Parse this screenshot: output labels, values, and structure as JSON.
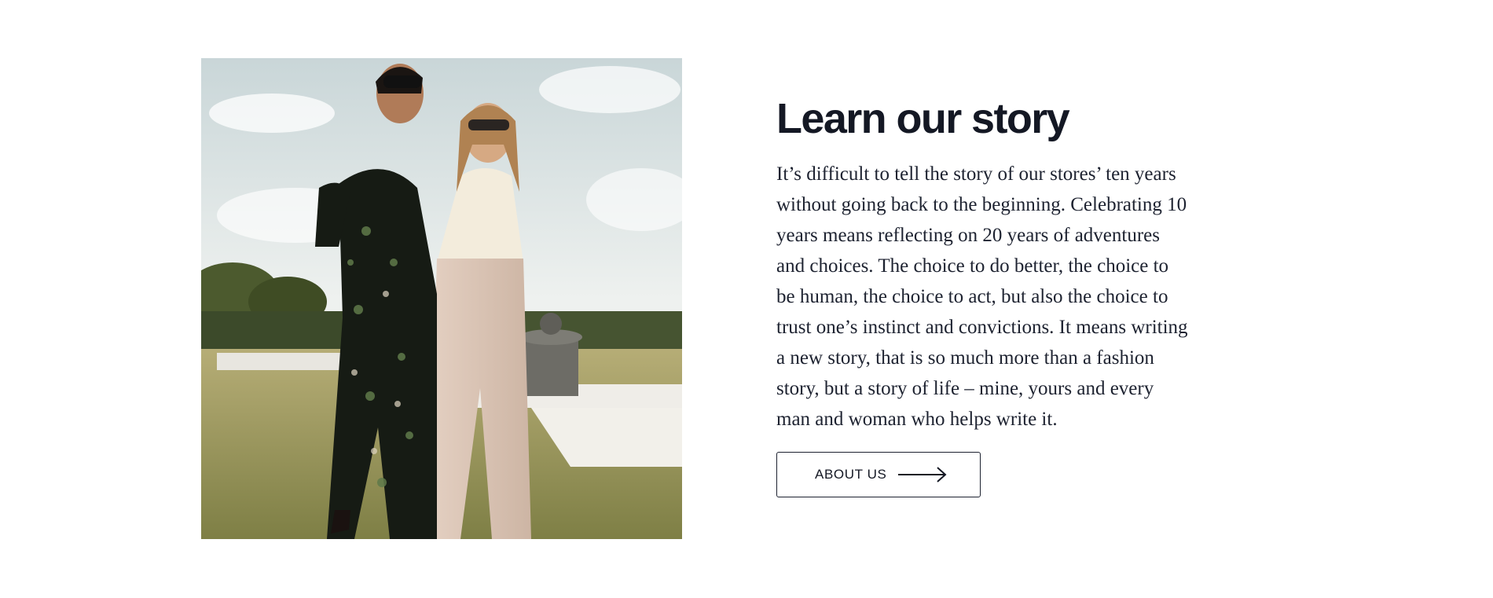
{
  "story": {
    "heading": "Learn our story",
    "body": "It’s difficult to tell the story of our stores’ ten years without going back to the beginning. Celebrating 10 years means reflecting on 20 years of adventures and choices. The choice to do better, the choice to be human, the choice to act, but also the choice to trust one’s instinct and convictions. It means writing a new story, that is so much more than a fashion story, but a story of life – mine, yours and every man and woman who helps write it.",
    "button_label": "ABOUT US",
    "button_icon": "arrow-right-icon"
  },
  "colors": {
    "text_dark": "#141824",
    "body_text": "#1d2230",
    "background": "#ffffff"
  }
}
